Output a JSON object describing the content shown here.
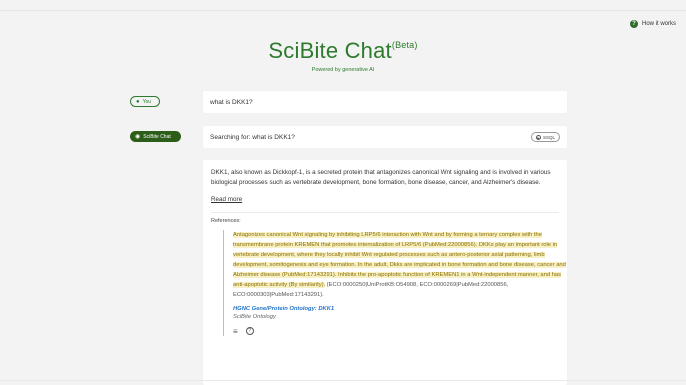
{
  "help": {
    "label": "How it works",
    "icon": "question-circle-icon"
  },
  "brand": {
    "title": "SciBite Chat",
    "beta": "(Beta)",
    "subtitle": "Powered by generative AI"
  },
  "user_pill": {
    "label": "You",
    "icon": "person-icon"
  },
  "bot_pill": {
    "label": "SciBite Chat",
    "icon": "robot-icon"
  },
  "question": {
    "text": "what is DKK1?"
  },
  "search": {
    "text": "Searching for: what is DKK1?",
    "ssql_label": "SSQL"
  },
  "answer": {
    "text": "DKK1, also known as Dickkopf-1, is a secreted protein that antagonizes canonical Wnt signaling and is involved in various biological processes such as vertebrate development, bone formation, bone disease, cancer, and Alzheimer's disease.",
    "read_more": "Read more",
    "references_label": "References:",
    "reference": {
      "highlighted": "Antagonizes canonical Wnt signaling by inhibiting LRP5/6 interaction with Wnt and by forming a ternary complex with the transmembrane protein KREMEN that promotes internalization of LRP5/6 (PubMed:22000856). DKKs play an important role in vertebrate development, where they locally inhibit Wnt regulated processes such as antero-posterior axial patterning, limb development, somitogenesis and eye formation. In the adult, Dkks are implicated in bone formation and bone disease, cancer and Alzheimer disease (PubMed:17143291). Inhibits the pro-apoptotic function of KREMEN1 in a Wnt-independent manner, and has anti-apoptotic activity (By similarity).",
      "tail": " {ECO:0000250|UniProtKB:O54908, ECO:0000269|PubMed:22000856, ECO:0000303|PubMed:17143291}.",
      "source": "HGNC Gene/Protein Ontology: DKK1",
      "ontology": "SciBite Ontology"
    }
  },
  "colors": {
    "brand_green": "#2c7a2c",
    "pill_dark": "#2c5e1a",
    "highlight_bg": "#f6f0c4",
    "link_blue": "#1f72c9"
  }
}
